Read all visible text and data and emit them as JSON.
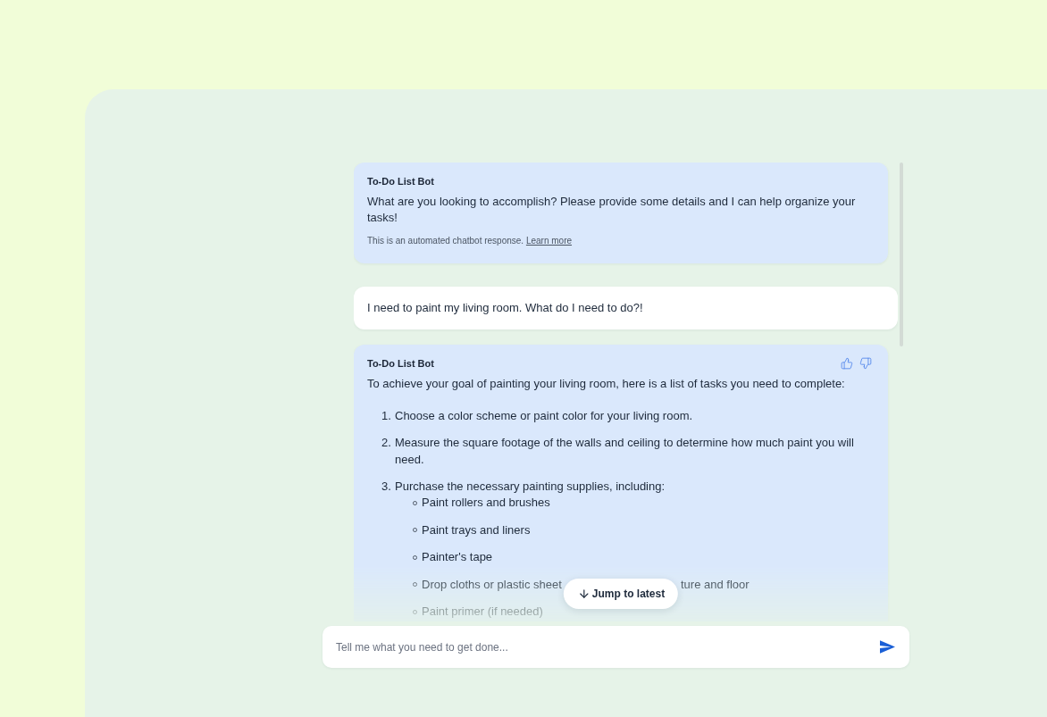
{
  "messages": [
    {
      "kind": "bot",
      "sender": "To-Do List Bot",
      "feedback": false,
      "text": "What are you looking to accomplish? Please provide some details and I can help organize your tasks!",
      "note": "This is an automated chatbot response.",
      "note_link": "Learn more"
    },
    {
      "kind": "user",
      "text": "I need to paint my living room. What do I need to do?!"
    },
    {
      "kind": "bot",
      "sender": "To-Do List Bot",
      "feedback": true,
      "text": "To achieve your goal of painting your living room, here is a list of tasks you need to complete:",
      "steps": [
        {
          "number": "1.",
          "text": "Choose a color scheme or paint color for your living room."
        },
        {
          "number": "2.",
          "text": "Measure the square footage of the walls and ceiling to determine how much paint you will need."
        },
        {
          "number": "3.",
          "text": "Purchase the necessary painting supplies, including:",
          "children": [
            {
              "kind": "plain",
              "text": "Paint rollers and brushes"
            },
            {
              "kind": "plain",
              "text": "Paint trays and liners"
            },
            {
              "kind": "plain",
              "text": "Painter's tape"
            },
            {
              "kind": "split",
              "parts": [
                "Drop cloths or plastic sheet",
                "ture and floor"
              ]
            },
            {
              "kind": "plain",
              "text": "Paint primer (if needed)"
            }
          ]
        }
      ]
    }
  ],
  "jump_button": {
    "label": "Jump to latest"
  },
  "composer": {
    "placeholder": "Tell me what you need to get done..."
  }
}
